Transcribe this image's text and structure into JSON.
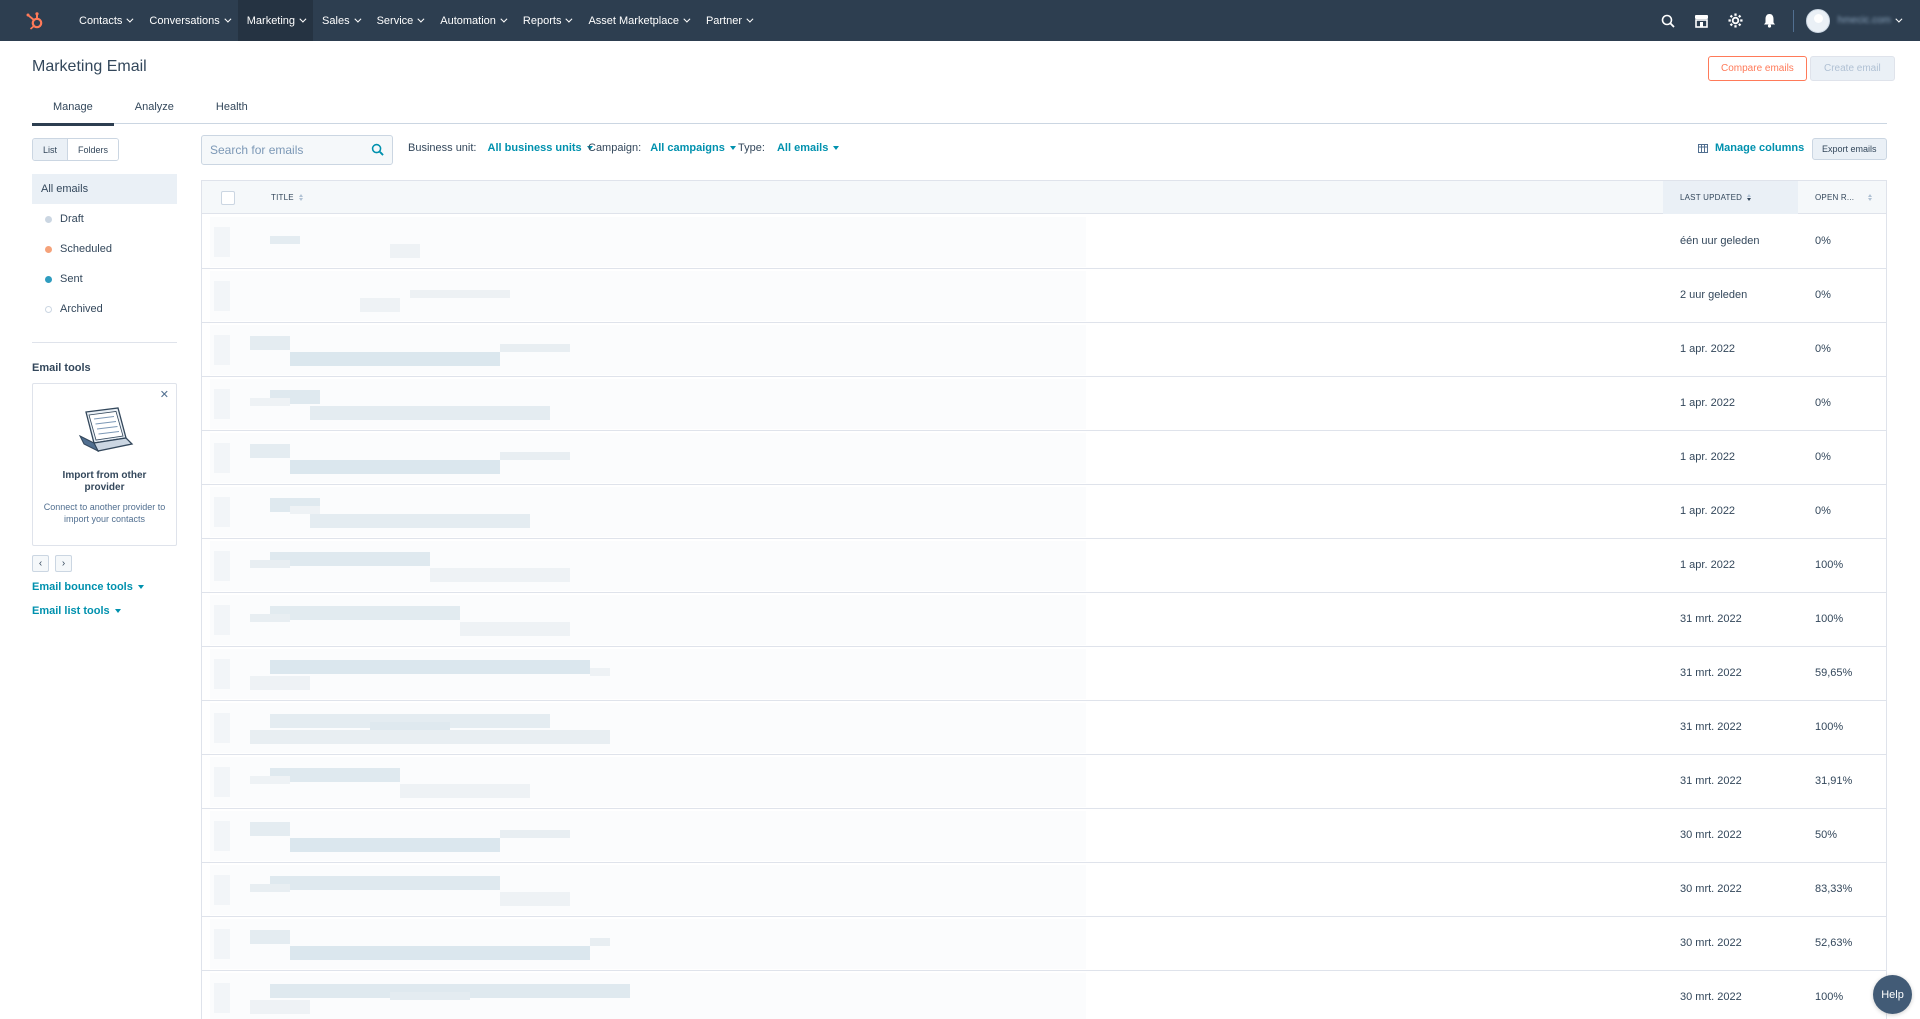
{
  "nav": {
    "items": [
      {
        "label": "Contacts",
        "key": "contacts"
      },
      {
        "label": "Conversations",
        "key": "conversations"
      },
      {
        "label": "Marketing",
        "key": "marketing",
        "active": true
      },
      {
        "label": "Sales",
        "key": "sales"
      },
      {
        "label": "Service",
        "key": "service"
      },
      {
        "label": "Automation",
        "key": "automation"
      },
      {
        "label": "Reports",
        "key": "reports"
      },
      {
        "label": "Asset Marketplace",
        "key": "asset-marketplace"
      },
      {
        "label": "Partner",
        "key": "partner"
      }
    ],
    "account_name": "hmecic.com"
  },
  "header": {
    "title": "Marketing Email",
    "compare_label": "Compare emails",
    "create_label": "Create email"
  },
  "tabs": [
    {
      "label": "Manage",
      "active": true
    },
    {
      "label": "Analyze"
    },
    {
      "label": "Health"
    }
  ],
  "sidebar": {
    "view_list": "List",
    "view_folders": "Folders",
    "all_emails": "All emails",
    "statuses": [
      {
        "label": "Draft",
        "color": "#cbd6e2"
      },
      {
        "label": "Scheduled",
        "color": "#f5a27a"
      },
      {
        "label": "Sent",
        "color": "#2e9cbf"
      },
      {
        "label": "Archived",
        "color": "#ffffff"
      }
    ],
    "tools_title": "Email tools",
    "card_title": "Import from other provider",
    "card_text": "Connect to another provider to import your contacts",
    "bounce_tools": "Email bounce tools",
    "list_tools": "Email list tools"
  },
  "filters": {
    "search_placeholder": "Search for emails",
    "business_unit_label": "Business unit:",
    "business_unit_value": "All business units",
    "campaign_label": "Campaign:",
    "campaign_value": "All campaigns",
    "type_label": "Type:",
    "type_value": "All emails",
    "manage_columns": "Manage columns",
    "export": "Export emails"
  },
  "table": {
    "col_title": "TITLE",
    "col_updated": "LAST UPDATED",
    "col_open": "OPEN R...",
    "rows": [
      {
        "updated": "één uur geleden",
        "open": "0%"
      },
      {
        "updated": "2 uur geleden",
        "open": "0%"
      },
      {
        "updated": "1 apr. 2022",
        "open": "0%"
      },
      {
        "updated": "1 apr. 2022",
        "open": "0%"
      },
      {
        "updated": "1 apr. 2022",
        "open": "0%"
      },
      {
        "updated": "1 apr. 2022",
        "open": "0%"
      },
      {
        "updated": "1 apr. 2022",
        "open": "100%"
      },
      {
        "updated": "31 mrt. 2022",
        "open": "100%"
      },
      {
        "updated": "31 mrt. 2022",
        "open": "59,65%"
      },
      {
        "updated": "31 mrt. 2022",
        "open": "100%"
      },
      {
        "updated": "31 mrt. 2022",
        "open": "31,91%"
      },
      {
        "updated": "30 mrt. 2022",
        "open": "50%"
      },
      {
        "updated": "30 mrt. 2022",
        "open": "83,33%"
      },
      {
        "updated": "30 mrt. 2022",
        "open": "52,63%"
      },
      {
        "updated": "30 mrt. 2022",
        "open": "100%"
      }
    ]
  },
  "help_label": "Help",
  "colors": {
    "nav_bg": "#2d3e50",
    "accent": "#ff7a59",
    "link": "#0091ae"
  }
}
